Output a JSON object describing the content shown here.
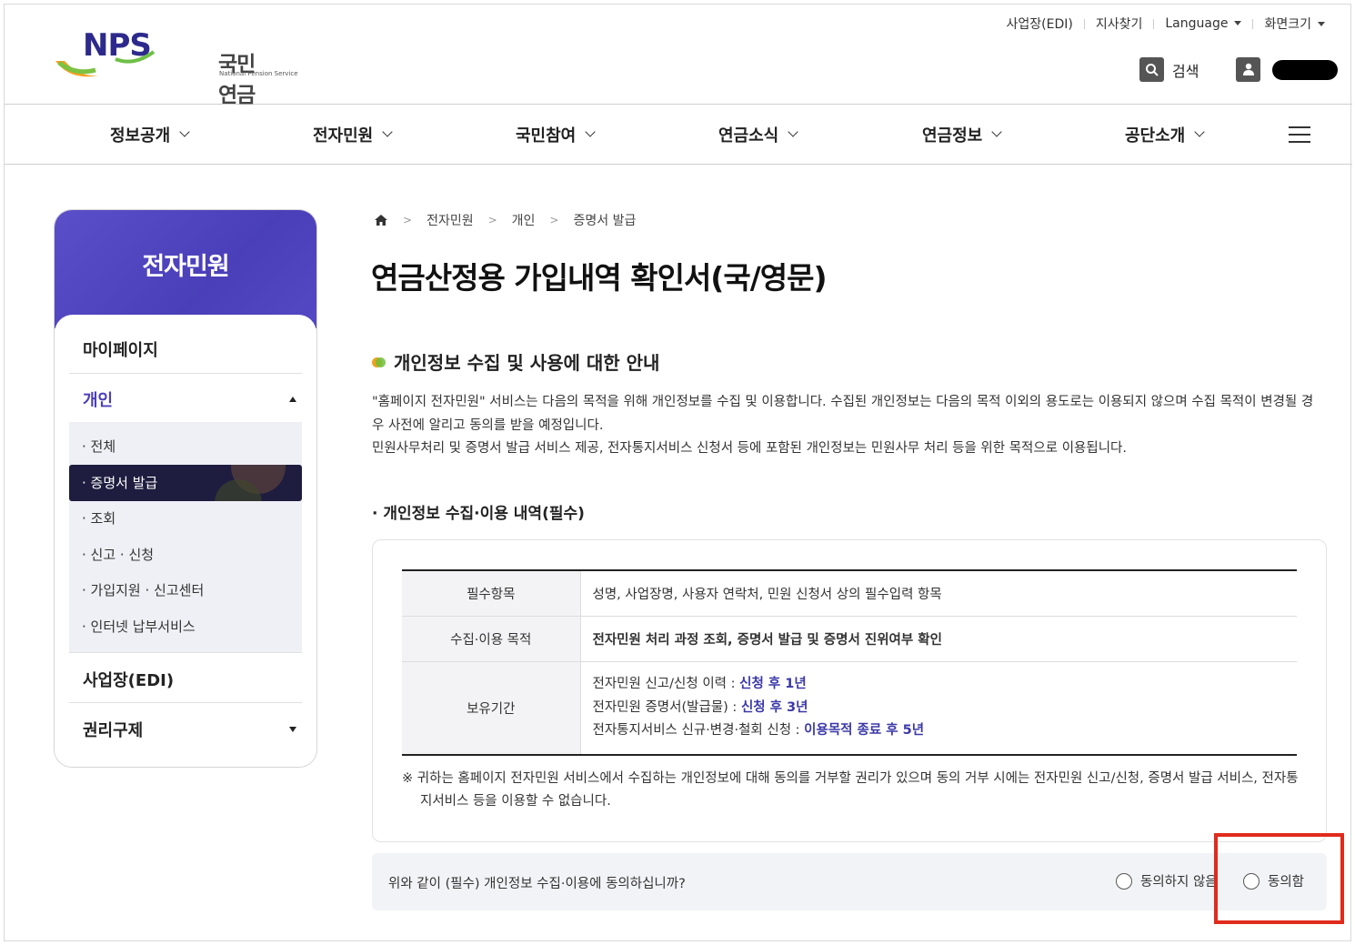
{
  "header": {
    "logo_text": "NPS",
    "logo_kor": "국민연금",
    "logo_sub": "National Pension Service",
    "util": [
      "사업장(EDI)",
      "지사찾기",
      "Language",
      "화면크기"
    ],
    "search_label": "검색"
  },
  "gnb": [
    "정보공개",
    "전자민원",
    "국민참여",
    "연금소식",
    "연금정보",
    "공단소개"
  ],
  "sidebar": {
    "title": "전자민원",
    "items": {
      "mypage": "마이페이지",
      "personal": "개인",
      "edi": "사업장(EDI)",
      "rights": "권리구제"
    },
    "sub_items": [
      "· 전체",
      "· 증명서 발급",
      "· 조회",
      "· 신고 · 신청",
      "· 가입지원 · 신고센터",
      "· 인터넷 납부서비스"
    ]
  },
  "breadcrumb": [
    "전자민원",
    "개인",
    "증명서 발급"
  ],
  "page_title": "연금산정용 가입내역 확인서(국/영문)",
  "section_title": "개인정보 수집 및 사용에 대한 안내",
  "paragraph": {
    "line1": "\"홈페이지 전자민원\" 서비스는 다음의 목적을 위해 개인정보를 수집 및 이용합니다. 수집된 개인정보는 다음의 목적 이외의 용도로는 이용되지 않으며 수집 목적이 변경될 경우 사전에 알리고 동의를 받을 예정입니다.",
    "line2": "민원사무처리 및 증명서 발급 서비스 제공, 전자통지서비스 신청서 등에 포함된 개인정보는 민원사무 처리 등을 위한 목적으로 이용됩니다."
  },
  "subsection_title": "· 개인정보 수집·이용 내역(필수)",
  "table": {
    "row1_head": "필수항목",
    "row1_value": "성명, 사업장명, 사용자 연락처, 민원 신청서 상의 필수입력 항목",
    "row2_head": "수집·이용 목적",
    "row2_value": "전자민원 처리 과정 조회, 증명서 발급 및 증명서 진위여부 확인",
    "row3_head": "보유기간",
    "row3_lines": [
      {
        "label": "전자민원 신고/신청 이력 : ",
        "value": "신청 후 1년"
      },
      {
        "label": "전자민원 증명서(발급물) : ",
        "value": "신청 후 3년"
      },
      {
        "label": "전자통지서비스 신규·변경·철회 신청 : ",
        "value": "이용목적 종료 후 5년"
      }
    ]
  },
  "note": "※ 귀하는 홈페이지 전자민원 서비스에서 수집하는 개인정보에 대해 동의를 거부할 권리가 있으며 동의 거부 시에는 전자민원 신고/신청, 증명서 발급 서비스, 전자통지서비스 등을 이용할 수 없습니다.",
  "agree": {
    "question": "위와 같이 (필수) 개인정보 수집·이용에 동의하십니까?",
    "disagree_label": "동의하지 않음",
    "agree_label": "동의함"
  },
  "colors": {
    "accent": "#4a3fb8",
    "active_menu": "#1e1d3f",
    "highlight_text": "#3b39a8",
    "annotation_box": "#e02b1c"
  }
}
